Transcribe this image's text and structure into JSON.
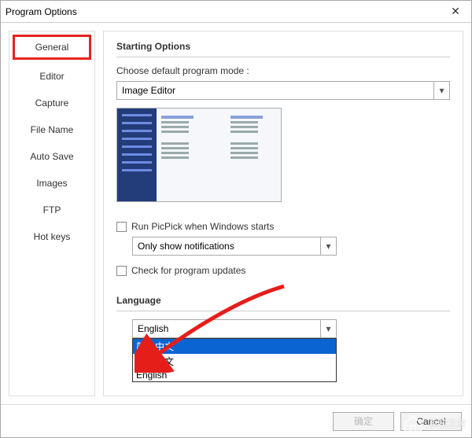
{
  "window": {
    "title": "Program Options"
  },
  "sidebar": {
    "items": [
      {
        "label": "General",
        "active": true
      },
      {
        "label": "Editor"
      },
      {
        "label": "Capture"
      },
      {
        "label": "File Name"
      },
      {
        "label": "Auto Save"
      },
      {
        "label": "Images"
      },
      {
        "label": "FTP"
      },
      {
        "label": "Hot keys"
      }
    ]
  },
  "starting": {
    "heading": "Starting Options",
    "choose_label": "Choose default program mode :",
    "mode_selected": "Image Editor",
    "run_on_start_label": "Run PicPick when Windows starts",
    "notify_selected": "Only show notifications",
    "check_updates_label": "Check for program updates"
  },
  "language": {
    "heading": "Language",
    "selected": "English",
    "options": [
      {
        "label": "简体中文",
        "selected": true
      },
      {
        "label": "正體中文"
      },
      {
        "label": "English"
      }
    ]
  },
  "footer": {
    "ok_label": "确定",
    "cancel_label": "Cancel"
  },
  "watermark": {
    "text": "系统之家"
  }
}
